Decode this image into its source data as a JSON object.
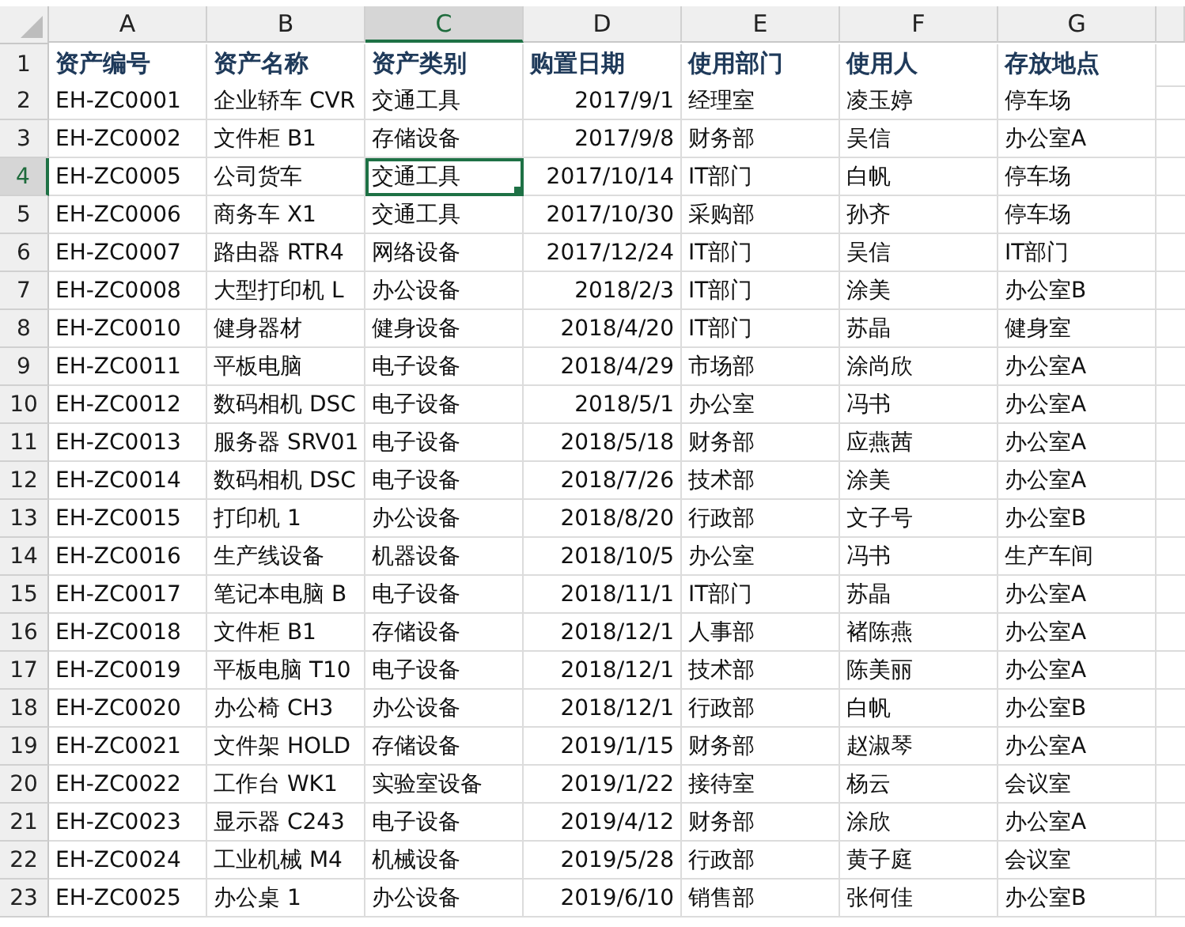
{
  "columns": [
    {
      "label": "A",
      "kind": "text",
      "selected": false
    },
    {
      "label": "B",
      "kind": "text",
      "selected": false
    },
    {
      "label": "C",
      "kind": "text",
      "selected": true
    },
    {
      "label": "D",
      "kind": "date",
      "selected": false
    },
    {
      "label": "E",
      "kind": "text",
      "selected": false
    },
    {
      "label": "F",
      "kind": "text",
      "selected": false
    },
    {
      "label": "G",
      "kind": "text",
      "selected": false
    }
  ],
  "rows": [
    {
      "number": "1",
      "kind": "header",
      "selected": false,
      "cells": [
        "资产编号",
        "资产名称",
        "资产类别",
        "购置日期",
        "使用部门",
        "使用人",
        "存放地点"
      ]
    },
    {
      "number": "2",
      "kind": "data",
      "selected": false,
      "cells": [
        "EH-ZC0001",
        "企业轿车 CVR",
        "交通工具",
        "2017/9/1",
        "经理室",
        "凌玉婷",
        "停车场"
      ]
    },
    {
      "number": "3",
      "kind": "data",
      "selected": false,
      "cells": [
        "EH-ZC0002",
        "文件柜 B1",
        "存储设备",
        "2017/9/8",
        "财务部",
        "吴信",
        "办公室A"
      ]
    },
    {
      "number": "4",
      "kind": "data",
      "selected": true,
      "cells": [
        "EH-ZC0005",
        "公司货车",
        "交通工具",
        "2017/10/14",
        "IT部门",
        "白帆",
        "停车场"
      ]
    },
    {
      "number": "5",
      "kind": "data",
      "selected": false,
      "cells": [
        "EH-ZC0006",
        "商务车 X1",
        "交通工具",
        "2017/10/30",
        "采购部",
        "孙齐",
        "停车场"
      ]
    },
    {
      "number": "6",
      "kind": "data",
      "selected": false,
      "cells": [
        "EH-ZC0007",
        "路由器 RTR4",
        "网络设备",
        "2017/12/24",
        "IT部门",
        "吴信",
        "IT部门"
      ]
    },
    {
      "number": "7",
      "kind": "data",
      "selected": false,
      "cells": [
        "EH-ZC0008",
        "大型打印机 L",
        "办公设备",
        "2018/2/3",
        "IT部门",
        "涂美",
        "办公室B"
      ]
    },
    {
      "number": "8",
      "kind": "data",
      "selected": false,
      "cells": [
        "EH-ZC0010",
        "健身器材",
        "健身设备",
        "2018/4/20",
        "IT部门",
        "苏晶",
        "健身室"
      ]
    },
    {
      "number": "9",
      "kind": "data",
      "selected": false,
      "cells": [
        "EH-ZC0011",
        "平板电脑",
        "电子设备",
        "2018/4/29",
        "市场部",
        "涂尚欣",
        "办公室A"
      ]
    },
    {
      "number": "10",
      "kind": "data",
      "selected": false,
      "cells": [
        "EH-ZC0012",
        "数码相机 DSC",
        "电子设备",
        "2018/5/1",
        "办公室",
        "冯书",
        "办公室A"
      ]
    },
    {
      "number": "11",
      "kind": "data",
      "selected": false,
      "cells": [
        "EH-ZC0013",
        "服务器 SRV01",
        "电子设备",
        "2018/5/18",
        "财务部",
        "应燕茜",
        "办公室A"
      ]
    },
    {
      "number": "12",
      "kind": "data",
      "selected": false,
      "cells": [
        "EH-ZC0014",
        "数码相机 DSC",
        "电子设备",
        "2018/7/26",
        "技术部",
        "涂美",
        "办公室A"
      ]
    },
    {
      "number": "13",
      "kind": "data",
      "selected": false,
      "cells": [
        "EH-ZC0015",
        "打印机 1",
        "办公设备",
        "2018/8/20",
        "行政部",
        "文子号",
        "办公室B"
      ]
    },
    {
      "number": "14",
      "kind": "data",
      "selected": false,
      "cells": [
        "EH-ZC0016",
        "生产线设备",
        "机器设备",
        "2018/10/5",
        "办公室",
        "冯书",
        "生产车间"
      ]
    },
    {
      "number": "15",
      "kind": "data",
      "selected": false,
      "cells": [
        "EH-ZC0017",
        "笔记本电脑 B",
        "电子设备",
        "2018/11/1",
        "IT部门",
        "苏晶",
        "办公室A"
      ]
    },
    {
      "number": "16",
      "kind": "data",
      "selected": false,
      "cells": [
        "EH-ZC0018",
        "文件柜 B1",
        "存储设备",
        "2018/12/1",
        "人事部",
        "褚陈燕",
        "办公室A"
      ]
    },
    {
      "number": "17",
      "kind": "data",
      "selected": false,
      "cells": [
        "EH-ZC0019",
        "平板电脑 T10",
        "电子设备",
        "2018/12/1",
        "技术部",
        "陈美丽",
        "办公室A"
      ]
    },
    {
      "number": "18",
      "kind": "data",
      "selected": false,
      "cells": [
        "EH-ZC0020",
        "办公椅 CH3",
        "办公设备",
        "2018/12/1",
        "行政部",
        "白帆",
        "办公室B"
      ]
    },
    {
      "number": "19",
      "kind": "data",
      "selected": false,
      "cells": [
        "EH-ZC0021",
        "文件架 HOLD",
        "存储设备",
        "2019/1/15",
        "财务部",
        "赵淑琴",
        "办公室A"
      ]
    },
    {
      "number": "20",
      "kind": "data",
      "selected": false,
      "cells": [
        "EH-ZC0022",
        "工作台 WK1",
        "实验室设备",
        "2019/1/22",
        "接待室",
        "杨云",
        "会议室"
      ]
    },
    {
      "number": "21",
      "kind": "data",
      "selected": false,
      "cells": [
        "EH-ZC0023",
        "显示器 C243",
        "电子设备",
        "2019/4/12",
        "财务部",
        "涂欣",
        "办公室A"
      ]
    },
    {
      "number": "22",
      "kind": "data",
      "selected": false,
      "cells": [
        "EH-ZC0024",
        "工业机械 M4",
        "机械设备",
        "2019/5/28",
        "行政部",
        "黄子庭",
        "会议室"
      ]
    },
    {
      "number": "23",
      "kind": "data",
      "selected": false,
      "cells": [
        "EH-ZC0025",
        "办公桌 1",
        "办公设备",
        "2019/6/10",
        "销售部",
        "张何佳",
        "办公室B"
      ]
    }
  ]
}
